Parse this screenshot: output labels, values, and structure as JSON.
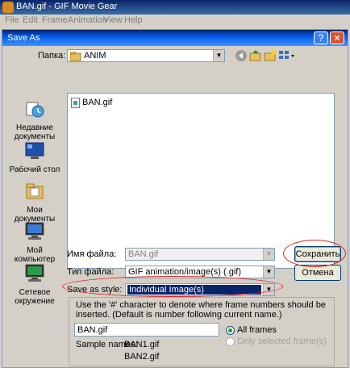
{
  "app": {
    "title": "BAN.gif - GIF Movie Gear",
    "menu": [
      "File",
      "Edit",
      "Frame",
      "Animation",
      "View",
      "Help"
    ]
  },
  "dialog": {
    "title": "Save As",
    "help_glyph": "?",
    "close_glyph": "×",
    "folder_label": "Папка:",
    "folder_value": "ANIM",
    "places": [
      {
        "label": "Недавние документы",
        "icon": "recent-documents-icon"
      },
      {
        "label": "Рабочий стол",
        "icon": "desktop-icon"
      },
      {
        "label": "Мои документы",
        "icon": "my-documents-icon"
      },
      {
        "label": "Мой компьютер",
        "icon": "my-computer-icon"
      },
      {
        "label": "Сетевое окружение",
        "icon": "network-icon"
      }
    ],
    "files": [
      "BAN.gif"
    ],
    "filename_label": "Имя файла:",
    "filename_value": "BAN.gif",
    "filetype_label": "Тип файла:",
    "filetype_value": "GIF animation/image(s) (.gif)",
    "style_label": "Save as style:",
    "style_value": "Individual Image(s)",
    "save_button": "Сохранить",
    "cancel_button": "Отмена",
    "note": "Use the '#' character to denote where frame numbers should be inserted. (Default is number following current name.)",
    "pattern_value": "BAN.gif",
    "sample_label": "Sample names:",
    "sample1": "BAN1.gif",
    "sample2": "BAN2.gif",
    "all_frames": "All frames",
    "only_selected": "Only selected frame(s)",
    "highlight_color": "#e02020",
    "accent_color": "#0a246a"
  }
}
